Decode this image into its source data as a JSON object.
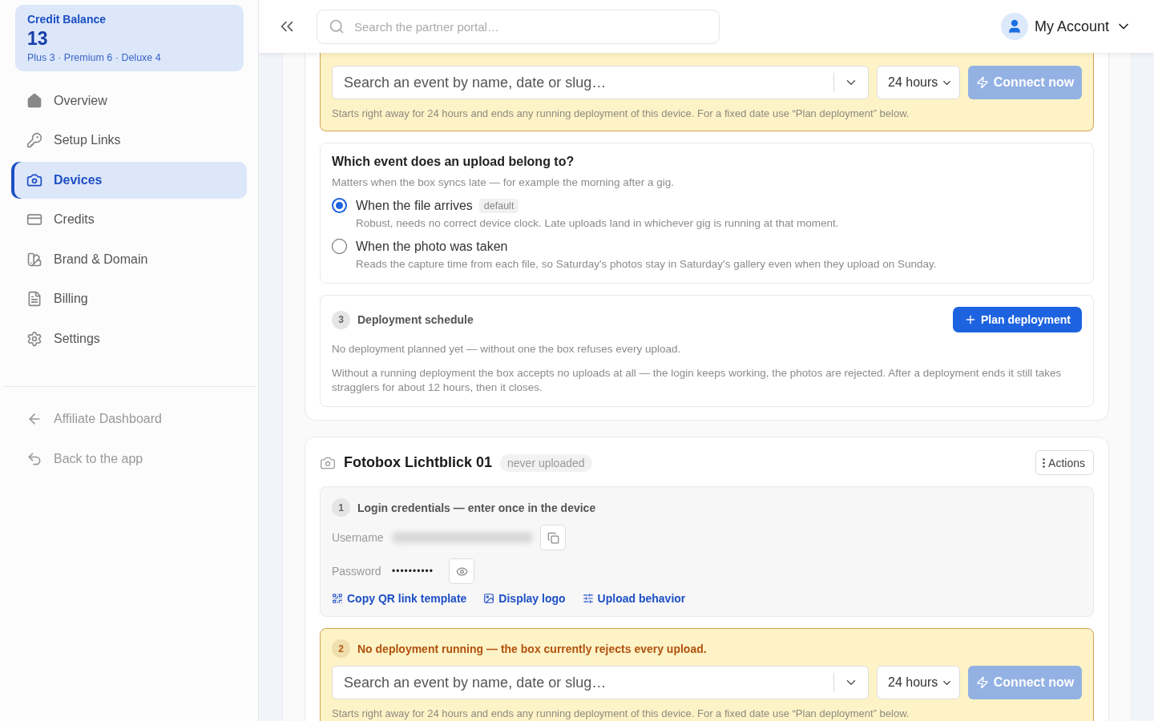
{
  "sidebar": {
    "credit_balance": {
      "label": "Credit Balance",
      "value": "13",
      "breakdown": "Plus 3 · Premium 6 · Deluxe 4"
    },
    "nav": [
      {
        "kind": "home",
        "label": "Overview",
        "selected": false
      },
      {
        "kind": "key",
        "label": "Setup Links",
        "selected": false
      },
      {
        "kind": "camera",
        "label": "Devices",
        "selected": true
      },
      {
        "kind": "card",
        "label": "Credits",
        "selected": false
      },
      {
        "kind": "brand",
        "label": "Brand & Domain",
        "selected": false
      },
      {
        "kind": "file",
        "label": "Billing",
        "selected": false
      },
      {
        "kind": "gear",
        "label": "Settings",
        "selected": false
      }
    ],
    "footer_links": [
      {
        "kind": "arrow",
        "label": "Affiliate Dashboard"
      },
      {
        "kind": "back",
        "label": "Back to the app"
      }
    ]
  },
  "header": {
    "search_placeholder": "Search the partner portal…",
    "account": "My Account"
  },
  "devices": [
    {
      "deployment_now": {
        "event_placeholder": "Search an event by name, date or slug…",
        "duration": "24 hours",
        "button": "Connect now",
        "disabled": true,
        "hint": "Starts right away for 24 hours and ends any running deployment of this device. For a fixed date use “Plan deployment” below."
      },
      "upload_rule": {
        "title": "Which event does an upload belong to?",
        "subtitle": "Matters when the box syncs late — for example the morning after a gig.",
        "options": [
          {
            "label": "When the file arrives",
            "badge": "default",
            "description": "Robust, needs no correct device clock. Late uploads land in whichever gig is running at that moment.",
            "selected": true
          },
          {
            "label": "When the photo was taken",
            "description": "Reads the capture time from each file, so Saturday's photos stay in Saturday's gallery even when they upload on Sunday.",
            "selected": false
          }
        ]
      },
      "schedule": {
        "step": "3",
        "title": "Deployment schedule",
        "button": "Plan deployment",
        "empty": "No deployment planned yet — without one the box refuses every upload.",
        "note": "Without a running deployment the box accepts no uploads at all — the login keeps working, the photos are rejected. After a deployment ends it still takes stragglers for about 12 hours, then it closes."
      }
    },
    {
      "name": "Fotobox Lichtblick 01",
      "status": "never uploaded",
      "actions": "Actions",
      "credentials": {
        "step": "1",
        "title": "Login credentials — enter once in the device",
        "username_label": "Username",
        "password_label": "Password",
        "password": "••••••••••"
      },
      "links": [
        {
          "kind": "qr",
          "label": "Copy QR link template"
        },
        {
          "kind": "image",
          "label": "Display logo"
        },
        {
          "kind": "sliders",
          "label": "Upload behavior"
        }
      ],
      "deployment_now": {
        "step": "2",
        "title": "No deployment running — the box currently rejects every upload.",
        "event_placeholder": "Search an event by name, date or slug…",
        "duration": "24 hours",
        "button": "Connect now",
        "disabled": true,
        "hint": "Starts right away for 24 hours and ends any running deployment of this device. For a fixed date use “Plan deployment” below."
      }
    }
  ]
}
